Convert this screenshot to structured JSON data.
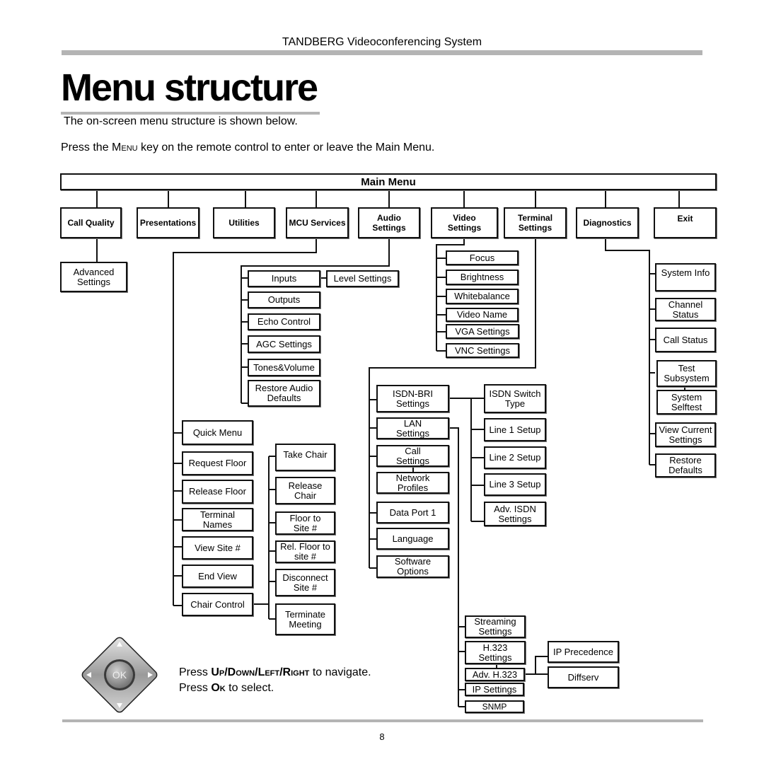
{
  "header": {
    "product": "TANDBERG Videoconferencing System"
  },
  "page": {
    "title": "Menu structure",
    "intro": "The on-screen menu structure is shown below.",
    "press_menu": {
      "before": "Press the ",
      "key": "Menu",
      "after": " key on the remote control to enter or leave the Main Menu."
    },
    "page_number": "8"
  },
  "main_menu": {
    "label": "Main Menu",
    "items": [
      {
        "label": "Call Quality"
      },
      {
        "label": "Presentations"
      },
      {
        "label": "Utilities"
      },
      {
        "label": "MCU Services"
      },
      {
        "label": "Audio\nSettings"
      },
      {
        "label": "Video\nSettings"
      },
      {
        "label": "Terminal\nSettings"
      },
      {
        "label": "Diagnostics"
      },
      {
        "label": "Exit"
      }
    ]
  },
  "call_quality": {
    "children": [
      "Advanced\nSettings"
    ]
  },
  "audio_settings": {
    "children": [
      "Inputs",
      "Outputs",
      "Echo Control",
      "AGC Settings",
      "Tones&Volume",
      "Restore Audio\nDefaults"
    ],
    "inputs_child": "Level Settings"
  },
  "video_settings": {
    "children": [
      "Focus",
      "Brightness",
      "Whitebalance",
      "Video Name",
      "VGA Settings",
      "VNC Settings"
    ]
  },
  "diagnostics": {
    "children": [
      "System Info",
      "Channel\nStatus",
      "Call Status",
      "Test\nSubsystem",
      "System\nSelftest",
      "View Current\nSettings",
      "Restore\nDefaults"
    ]
  },
  "mcu_services": {
    "children": [
      "Quick Menu",
      "Request Floor",
      "Release Floor",
      "Terminal\nNames",
      "View  Site #",
      "End  View",
      "Chair Control"
    ],
    "chair_control_children": [
      "Take Chair",
      "Release\nChair",
      "Floor to\nSite #",
      "Rel. Floor to\nsite #",
      "Disconnect\nSite #",
      "Terminate\nMeeting"
    ]
  },
  "terminal_settings": {
    "children": [
      "ISDN-BRI\nSettings",
      "LAN\nSettings",
      "Call\nSettings",
      "Network\nProfiles",
      "Data Port 1",
      "Language",
      "Software\nOptions"
    ],
    "isdn_children": [
      "ISDN Switch\nType",
      "Line 1 Setup",
      "Line 2 Setup",
      "Line 3 Setup",
      "Adv. ISDN\nSettings"
    ],
    "lan_children": [
      "Streaming\nSettings",
      "H.323\nSettings",
      "Adv.  H.323",
      "IP Settings",
      "SNMP"
    ],
    "adv_h323_children": [
      "IP Precedence",
      "Diffserv"
    ]
  },
  "navigation": {
    "line1": {
      "before": "Press ",
      "keys": "Up/Down/Left/Right",
      "after": " to navigate."
    },
    "line2": {
      "before": "Press ",
      "key": "Ok",
      "after": " to select."
    },
    "dpad_center_label": "OK"
  }
}
